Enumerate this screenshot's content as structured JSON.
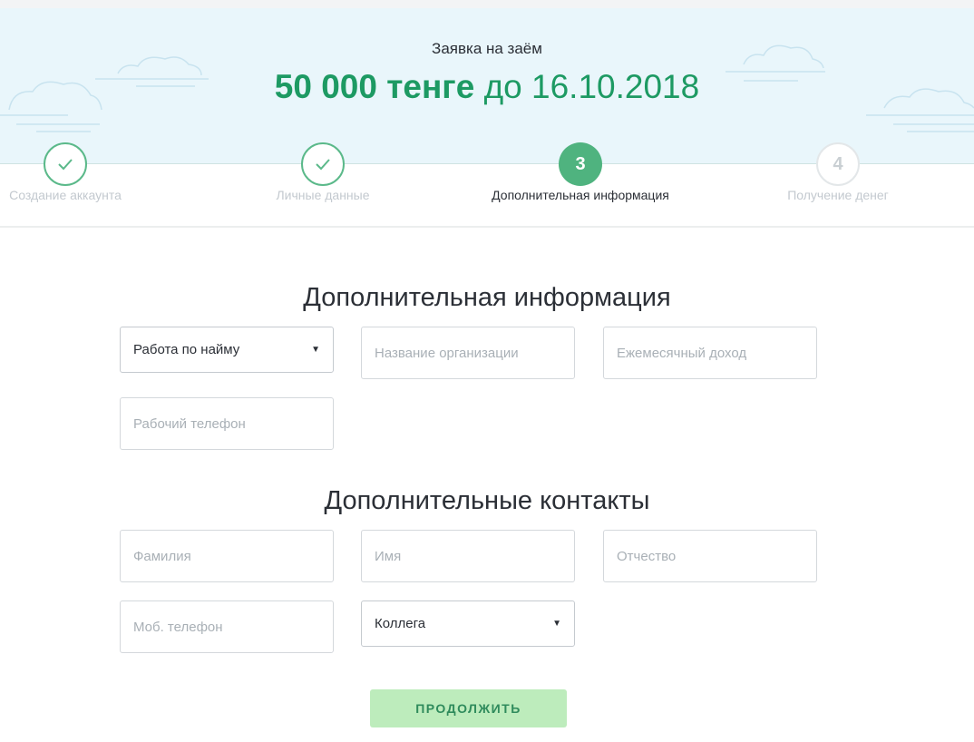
{
  "header": {
    "caption": "Заявка на заём",
    "amount": "50 000 тенге",
    "until": "до 16.10.2018"
  },
  "stepper": {
    "steps": [
      {
        "label": "Создание аккаунта",
        "state": "done",
        "icon": "check-icon"
      },
      {
        "label": "Личные данные",
        "state": "done",
        "icon": "check-icon"
      },
      {
        "label": "Дополнительная информация",
        "state": "active",
        "number": "3"
      },
      {
        "label": "Получение денег",
        "state": "todo",
        "number": "4"
      }
    ]
  },
  "additional_info": {
    "title": "Дополнительная информация",
    "employment_type": {
      "selected": "Работа по найму"
    },
    "organization": {
      "placeholder": "Название организации",
      "value": ""
    },
    "monthly_income": {
      "placeholder": "Ежемесячный доход",
      "value": ""
    },
    "work_phone": {
      "placeholder": "Рабочий телефон",
      "value": ""
    }
  },
  "additional_contacts": {
    "title": "Дополнительные контакты",
    "last_name": {
      "placeholder": "Фамилия",
      "value": ""
    },
    "first_name": {
      "placeholder": "Имя",
      "value": ""
    },
    "patronymic": {
      "placeholder": "Отчество",
      "value": ""
    },
    "mobile_phone": {
      "placeholder": "Моб. телефон",
      "value": ""
    },
    "relation": {
      "selected": "Коллега"
    }
  },
  "actions": {
    "continue_label": "ПРОДОЛЖИТЬ"
  },
  "colors": {
    "accent_green": "#1d9a63",
    "step_done": "#5bb98a",
    "step_active": "#4fb37f",
    "button_bg": "#bdecbc",
    "header_bg": "#e9f6fb"
  }
}
